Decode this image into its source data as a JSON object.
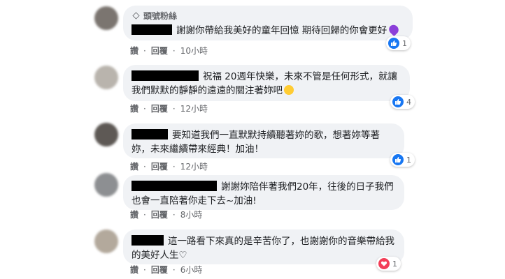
{
  "comments": [
    {
      "badge": "頭號粉絲",
      "text": "謝謝你帶給我美好的童年回憶 期待回歸的你會更好",
      "like_label": "讚",
      "reply_label": "回覆",
      "time": "10小時",
      "reaction": "like",
      "reaction_count": "1"
    },
    {
      "text": "祝福 20週年快樂，未來不管是任何形式，就讓我們默默的靜靜的遠遠的關注著妳吧",
      "like_label": "讚",
      "reply_label": "回覆",
      "time": "12小時",
      "reaction": "like",
      "reaction_count": "4"
    },
    {
      "text": "要知道我們一直默默持續聽著妳的歌，想著妳等著妳，未來繼續帶來經典！加油！",
      "like_label": "讚",
      "reply_label": "回覆",
      "time": "12小時",
      "reaction": "like",
      "reaction_count": "1"
    },
    {
      "text": "謝謝妳陪伴著我們20年，往後的日子我們也會一直陪著你走下去~加油!",
      "like_label": "讚",
      "reply_label": "回覆",
      "time": "8小時"
    },
    {
      "text": "這一路看下來真的是辛苦你了，也謝謝你的音樂帶給我的美好人生♡",
      "like_label": "讚",
      "reply_label": "回覆",
      "time": "6小時",
      "reaction": "love",
      "reaction_count": "1"
    }
  ],
  "colors": {
    "bubble": "#f0f2f5",
    "like": "#1877f2",
    "love": "#f33e58",
    "meta": "#65676b"
  }
}
